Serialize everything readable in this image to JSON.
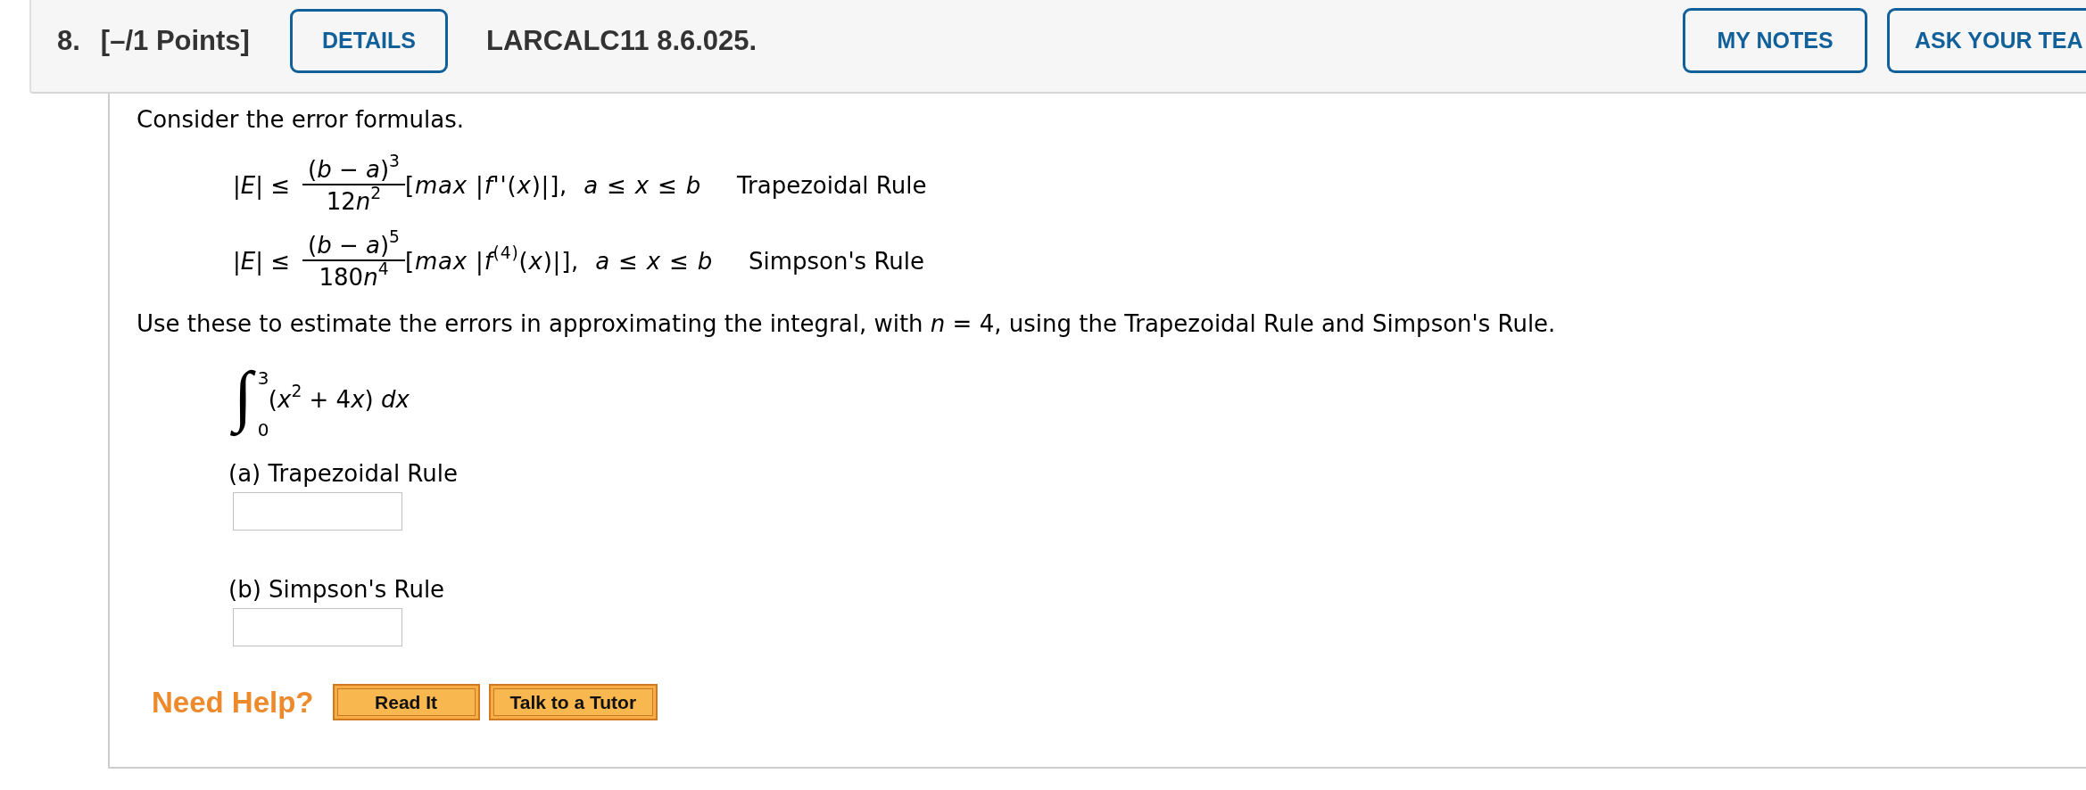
{
  "header": {
    "number": "8.",
    "points": "[–/1 Points]",
    "details_button": "DETAILS",
    "code": "LARCALC11 8.6.025.",
    "buttons": [
      {
        "label": "MY NOTES"
      },
      {
        "label": "ASK YOUR TEA"
      }
    ]
  },
  "content": {
    "intro": "Consider the error formulas.",
    "formulas": [
      {
        "lhs": "|*E*| ≤",
        "numerator": "(*b* − *a*)$^{3}$",
        "denominator": [
          {
            "kind": "number",
            "text": "12"
          },
          {
            "kind": "variable",
            "text": "n"
          },
          {
            "kind": "power",
            "text": "2"
          }
        ],
        "bound": "[*max* |*f*''(*x*)|],  *a* ≤ *x* ≤ *b*",
        "rule": "Trapezoidal Rule"
      },
      {
        "lhs": "|*E*| ≤",
        "numerator": "(*b* − *a*)$^{5}$",
        "denominator": [
          {
            "kind": "number",
            "text": "180"
          },
          {
            "kind": "variable",
            "text": "n"
          },
          {
            "kind": "power",
            "text": "4"
          }
        ],
        "bound": "[*max* |*f*$^{(4)}$(*x*)|],  *a* ≤ *x* ≤ *b*",
        "rule": "Simpson's Rule"
      }
    ],
    "instruction": "Use these to estimate the errors in approximating the integral, with *n* = 4, using the Trapezoidal Rule and Simpson's Rule.",
    "integral": {
      "sign": "∫",
      "upper": "3",
      "lower": "0",
      "integrand": [
        {
          "kind": "number",
          "text": "("
        },
        {
          "kind": "variable",
          "text": "x"
        },
        {
          "kind": "power",
          "text": "2"
        },
        {
          "kind": "number",
          "text": " + 4"
        },
        {
          "kind": "variable",
          "text": "x"
        },
        {
          "kind": "number",
          "text": ") "
        },
        {
          "kind": "variable",
          "text": "dx"
        }
      ]
    },
    "parts": [
      {
        "label": "(a) Trapezoidal Rule"
      },
      {
        "label": "(b) Simpson's Rule"
      }
    ],
    "help": {
      "label": "Need Help?",
      "buttons": [
        "Read It",
        "Talk to a Tutor"
      ]
    }
  }
}
